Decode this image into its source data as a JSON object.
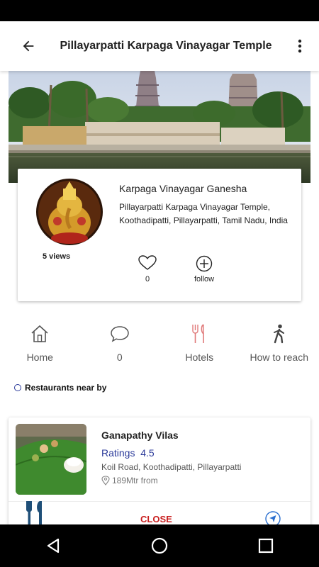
{
  "app_bar": {
    "title": "Pillayarpatti Karpaga Vinayagar Temple",
    "back_icon": "arrow-left-icon",
    "menu_icon": "more-vertical-icon"
  },
  "temple": {
    "deity_name": "Karpaga Vinayagar Ganesha",
    "address": "Pillayarpatti Karpaga Vinayagar Temple, Koothadipatti, Pillayarpatti, Tamil Nadu, India",
    "views": "5 views",
    "likes": "0",
    "follow_label": "follow"
  },
  "actions": [
    {
      "label": "Home",
      "icon": "home-icon"
    },
    {
      "label": "0",
      "icon": "comment-icon"
    },
    {
      "label": "Hotels",
      "icon": "fork-knife-icon"
    },
    {
      "label": "How to reach",
      "icon": "walking-icon"
    }
  ],
  "section_title": "Restaurants near by",
  "restaurant": {
    "name": "Ganapathy Vilas",
    "rating_label": "Ratings",
    "rating_value": "4.5",
    "address": "Koil Road, Koothadipatti, Pillayarpatti",
    "distance": "189Mtr from",
    "close_label": "CLOSE"
  },
  "colors": {
    "accent": "#2b3a9a",
    "close": "#c91f1f",
    "hotel_icon": "#e07a7a",
    "fork_dark": "#1f4f78"
  }
}
